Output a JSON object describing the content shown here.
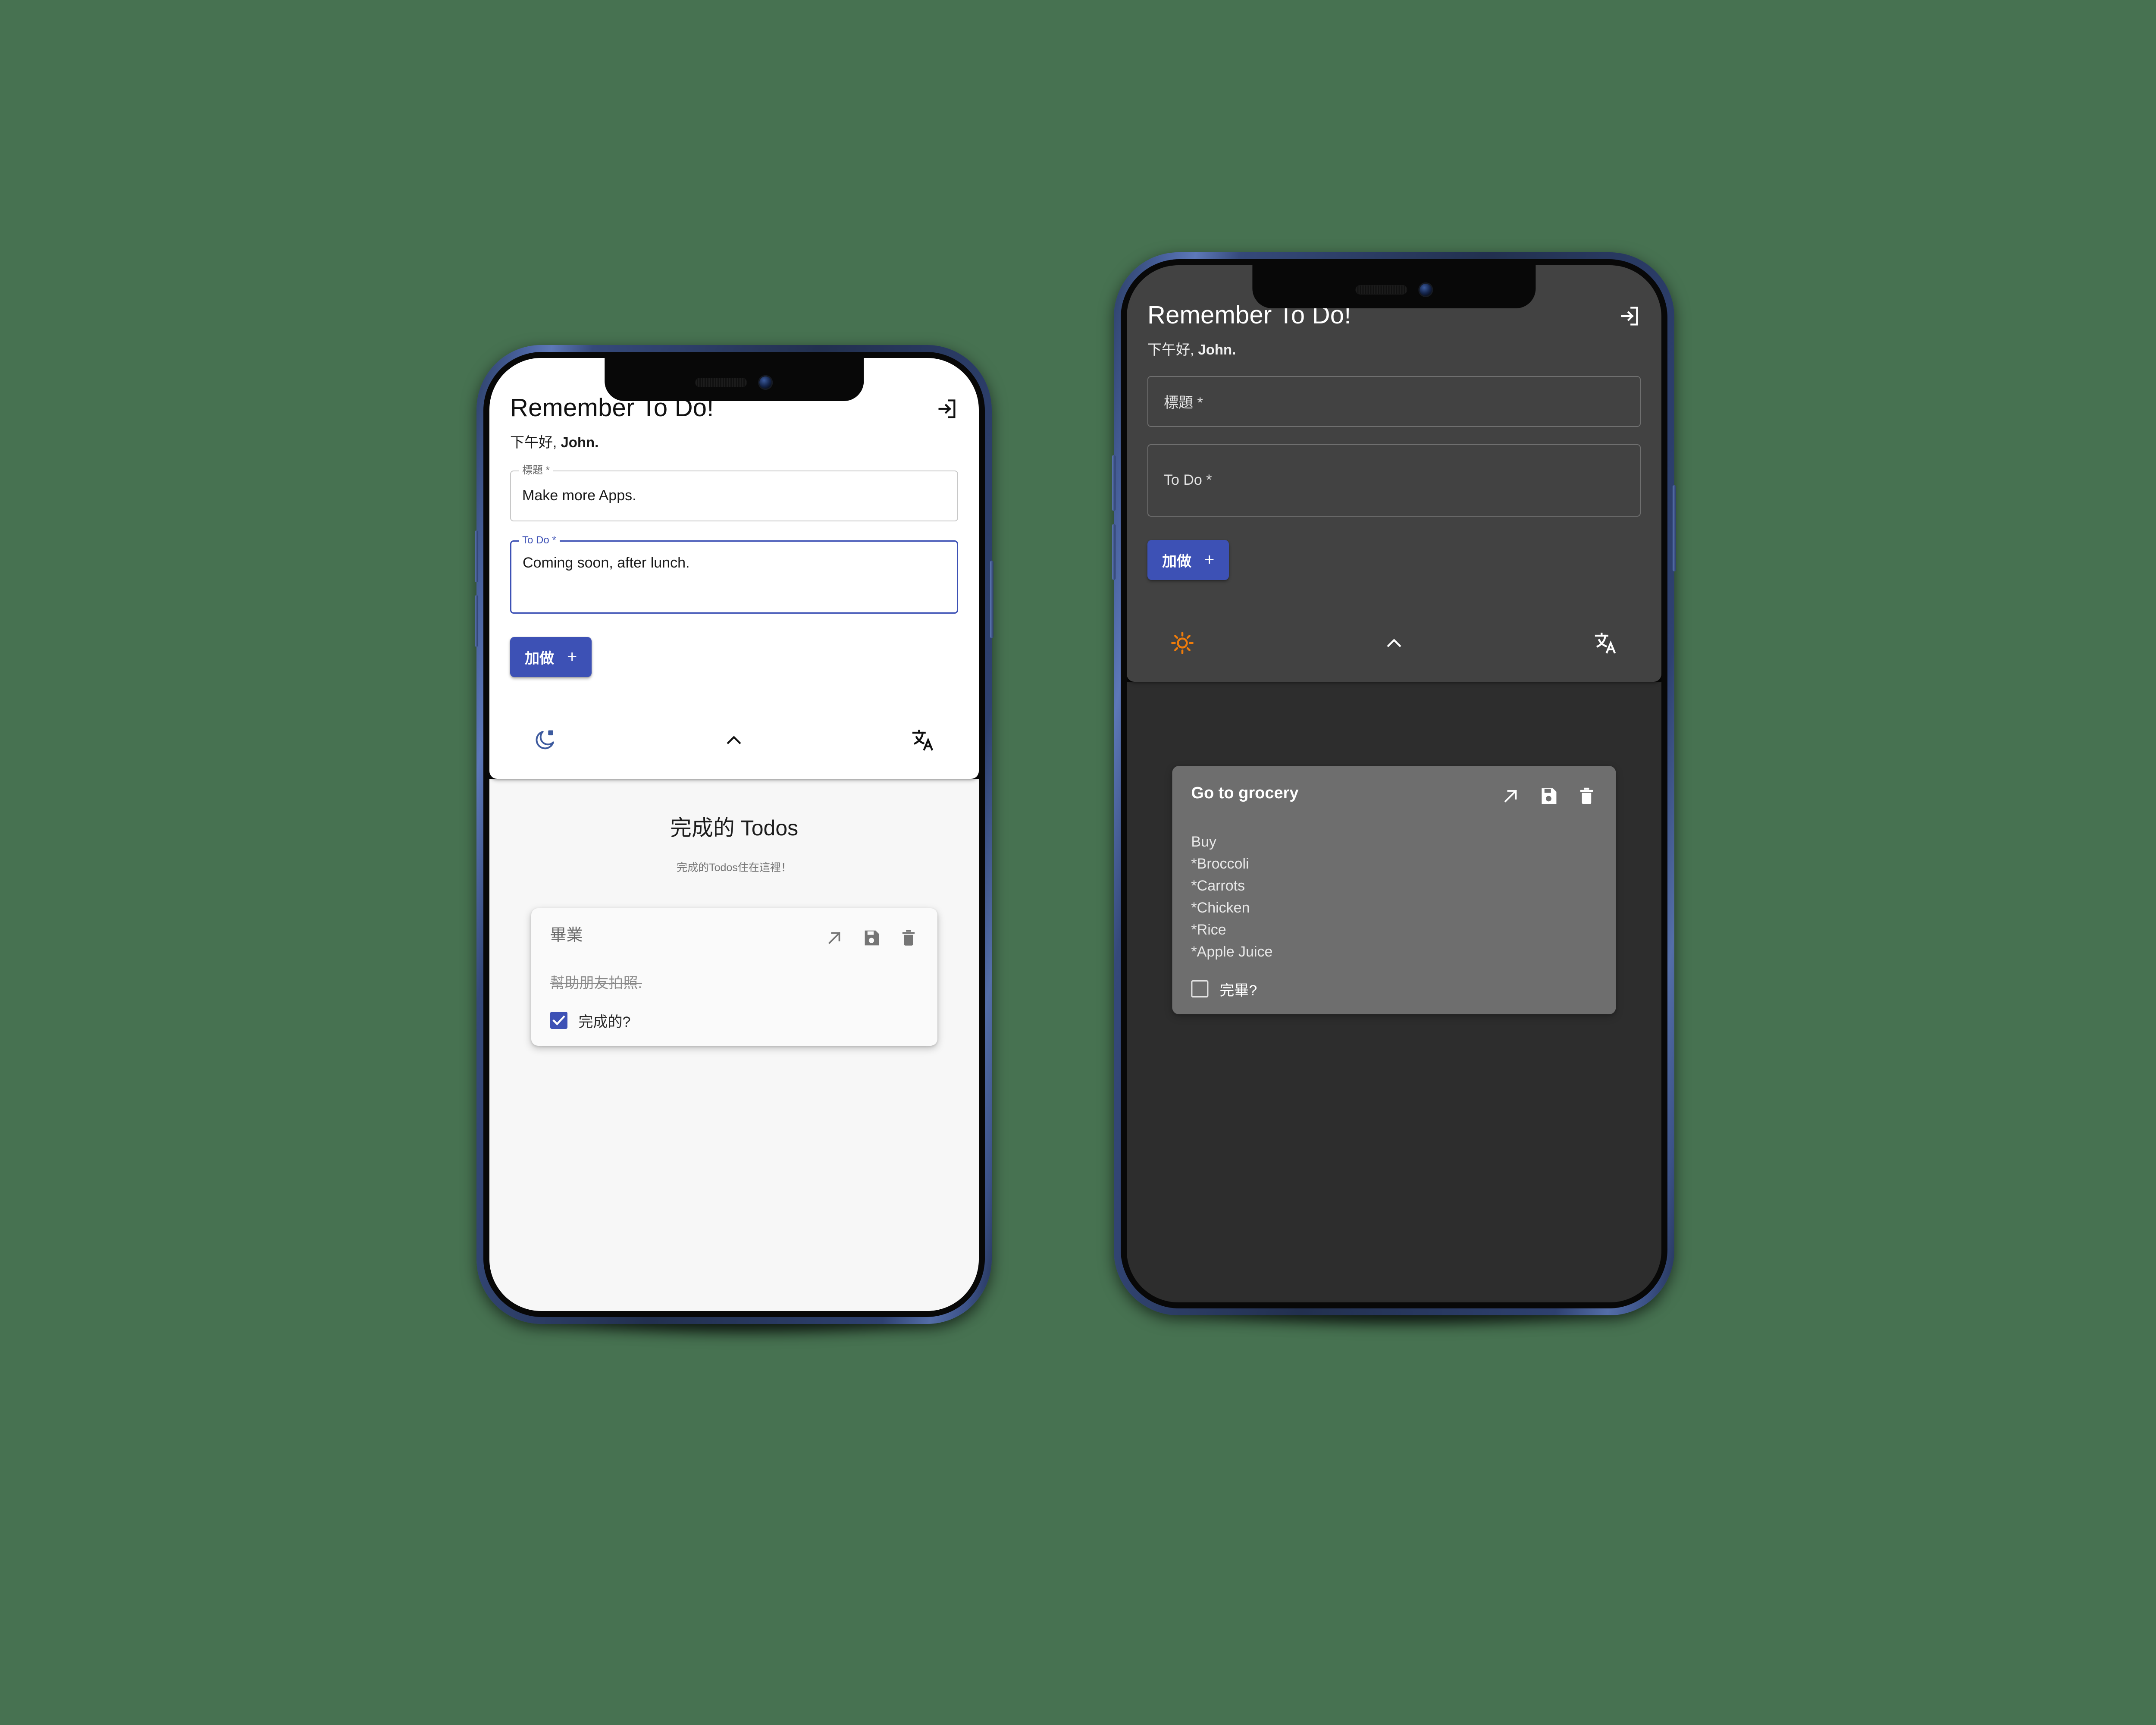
{
  "theme": {
    "page_bg": "#477251",
    "accent_blue": "#3d51b5",
    "sun_orange": "#f07c0a",
    "moon_blue": "#3d5a9e"
  },
  "light_phone": {
    "header": {
      "app_title": "Remember To Do!",
      "greeting_prefix": "下午好, ",
      "greeting_name": "John.",
      "logout_icon": "logout-icon"
    },
    "form": {
      "title_field": {
        "label": "標題 *",
        "value": "Make more Apps.",
        "focused": false
      },
      "todo_field": {
        "label": "To Do *",
        "value": "Coming soon, after lunch.",
        "focused": true
      },
      "add_button": {
        "label": "加做",
        "plus": "+"
      }
    },
    "toolbar": {
      "theme_toggle_icon": "moon-icon",
      "collapse_icon": "chevron-up-icon",
      "translate_icon": "translate-icon"
    },
    "completed": {
      "title": "完成的 Todos",
      "subtitle": "完成的Todos住在這裡！"
    },
    "card": {
      "title": "畢業",
      "body": "幫助朋友拍照.",
      "checkbox_label": "完成的?",
      "checked": true,
      "actions": [
        "expand-icon",
        "save-icon",
        "delete-icon"
      ]
    }
  },
  "dark_phone": {
    "header": {
      "app_title": "Remember To Do!",
      "greeting_prefix": "下午好, ",
      "greeting_name": "John.",
      "logout_icon": "logout-icon"
    },
    "form": {
      "title_field": {
        "label": "標題 *",
        "value": "",
        "placeholder": "標題 *"
      },
      "todo_field": {
        "label": "To Do *",
        "value": "",
        "placeholder": "To Do *"
      },
      "add_button": {
        "label": "加做",
        "plus": "+"
      }
    },
    "toolbar": {
      "theme_toggle_icon": "sun-icon",
      "collapse_icon": "chevron-up-icon",
      "translate_icon": "translate-icon"
    },
    "card": {
      "title": "Go to grocery",
      "body": "Buy\n*Broccoli\n*Carrots\n*Chicken\n*Rice\n*Apple Juice",
      "checkbox_label": "完畢?",
      "checked": false,
      "actions": [
        "expand-icon",
        "save-icon",
        "delete-icon"
      ]
    }
  }
}
